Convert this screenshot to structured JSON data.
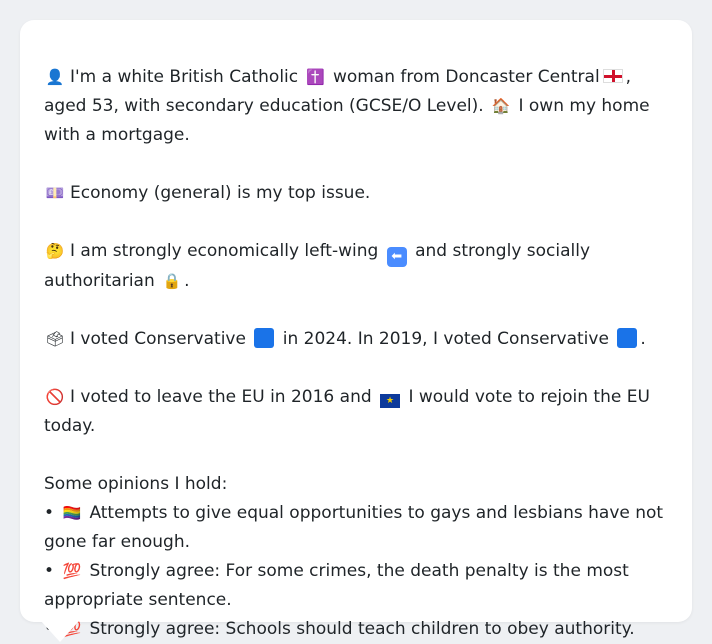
{
  "profile": {
    "line1_a": "I'm a white British Catholic",
    "line1_b": "woman from Doncaster Central",
    "line1_c": ", aged 53, with secondary education (GCSE/O Level).",
    "line1_d": "I own my home with a mortgage.",
    "issue": "Economy (general) is my top issue.",
    "ideology_a": "I am strongly economically left-wing",
    "ideology_b": "and strongly socially authoritarian",
    "ideology_c": ".",
    "votes_a": "I voted Conservative",
    "votes_b": "in 2024. In 2019, I voted Conservative",
    "votes_c": ".",
    "eu_a": "I voted to leave the EU in 2016 and",
    "eu_b": "I would vote to rejoin the EU today.",
    "opinions_heading": "Some opinions I hold:",
    "opinions": [
      "Attempts to give equal opportunities to gays and lesbians have not gone far enough.",
      "Strongly agree: For some crimes, the death penalty is the most appropriate sentence.",
      "Strongly agree: Schools should teach children to obey authority."
    ]
  },
  "icons": {
    "person": "person-icon",
    "cross": "latin-cross-icon",
    "flag_england": "flag-england-icon",
    "house": "house-icon",
    "money": "money-icon",
    "thinking": "thinking-face-icon",
    "left_arrow": "left-arrow-icon",
    "lock": "lock-icon",
    "ballot": "ballot-box-icon",
    "blue_square": "blue-square-icon",
    "prohibited": "prohibited-icon",
    "flag_eu": "flag-eu-icon",
    "rainbow": "rainbow-flag-icon",
    "hundred": "hundred-points-icon"
  },
  "colors": {
    "background": "#eef0f3",
    "card": "#ffffff",
    "text": "#1f2428",
    "conservative_blue": "#1a73e8"
  }
}
